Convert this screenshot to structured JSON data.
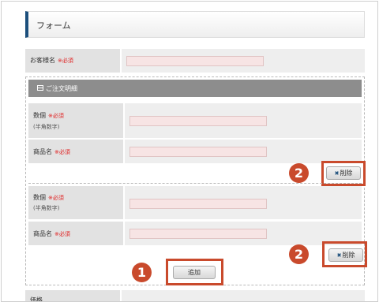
{
  "form": {
    "title": "フォーム",
    "required_mark": "※必須",
    "customer_name_label": "お客様名",
    "order_section_title": "ご注文明細",
    "items": [
      {
        "quantity_label": "数個",
        "quantity_note": "(半角数字)",
        "product_label": "商品名",
        "delete_label": "削除"
      },
      {
        "quantity_label": "数個",
        "quantity_note": "(半角数字)",
        "product_label": "商品名",
        "delete_label": "削除"
      }
    ],
    "add_label": "追加",
    "price_label": "価格"
  },
  "annotations": {
    "add_badge": "1",
    "delete_badge": "2",
    "accent_color": "#c94a2c"
  },
  "colors": {
    "title_accent": "#1c4f7c",
    "section_header": "#8d8d8d",
    "required": "#e01d1d",
    "input_bg": "#f7e4e4"
  }
}
